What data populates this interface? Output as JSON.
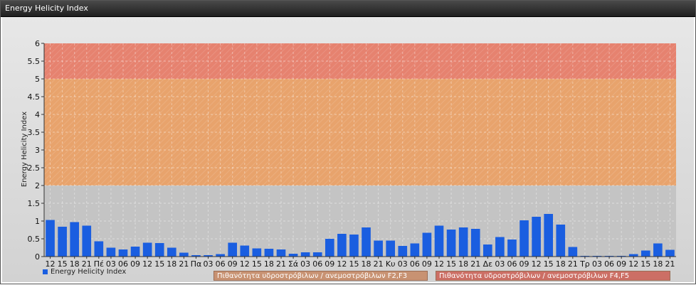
{
  "window": {
    "title": "Energy Helicity Index"
  },
  "colors": {
    "bar": "#1a5ee0",
    "band_f23": "#e8a36c",
    "band_f45": "#e6826f",
    "plot_bg": "#c4c4c4"
  },
  "legend": {
    "series_label": "Energy Helicity Index",
    "band_f23_label": "Πιθανότητα υδροστρόβιλων / ανεμοστρόβιλων F2,F3",
    "band_f45_label": "Πιθανότητα υδροστρόβιλων / ανεμοστρόβιλων F4,F5"
  },
  "chart_data": {
    "type": "bar",
    "title": "Energy Helicity Index",
    "ylabel": "Energy Helicity Index",
    "xlabel": "",
    "ylim": [
      0,
      6
    ],
    "yticks": [
      "0",
      "0.5",
      "1",
      "1.5",
      "2",
      "2.5",
      "3",
      "3.5",
      "4",
      "4.5",
      "5",
      "5.5",
      "6"
    ],
    "grid": true,
    "legend_position": "bottom-left",
    "bands": [
      {
        "from": 2,
        "to": 5,
        "label": "Πιθανότητα υδροστρόβιλων / ανεμοστρόβιλων F2,F3"
      },
      {
        "from": 5,
        "to": 6,
        "label": "Πιθανότητα υδροστρόβιλων / ανεμοστρόβιλων F4,F5"
      }
    ],
    "categories": [
      "12",
      "15",
      "18",
      "21",
      "Πέ",
      "03",
      "06",
      "09",
      "12",
      "15",
      "18",
      "21",
      "Πα",
      "03",
      "06",
      "09",
      "12",
      "15",
      "18",
      "21",
      "Σά",
      "03",
      "06",
      "09",
      "12",
      "15",
      "18",
      "21",
      "Κυ",
      "03",
      "06",
      "09",
      "12",
      "15",
      "18",
      "21",
      "Δε",
      "03",
      "06",
      "09",
      "12",
      "15",
      "18",
      "21",
      "Τρ",
      "03",
      "06",
      "09",
      "12",
      "15",
      "18",
      "21"
    ],
    "series": [
      {
        "name": "Energy Helicity Index",
        "values": [
          1.03,
          0.84,
          0.97,
          0.87,
          0.43,
          0.25,
          0.2,
          0.28,
          0.39,
          0.38,
          0.25,
          0.11,
          0.04,
          0.04,
          0.07,
          0.39,
          0.31,
          0.23,
          0.22,
          0.2,
          0.08,
          0.12,
          0.12,
          0.5,
          0.64,
          0.62,
          0.82,
          0.45,
          0.45,
          0.3,
          0.37,
          0.67,
          0.87,
          0.76,
          0.82,
          0.78,
          0.34,
          0.55,
          0.48,
          1.02,
          1.12,
          1.2,
          0.9,
          0.27,
          0.02,
          0.02,
          0.02,
          0.02,
          0.07,
          0.17,
          0.37,
          0.19
        ]
      }
    ]
  }
}
